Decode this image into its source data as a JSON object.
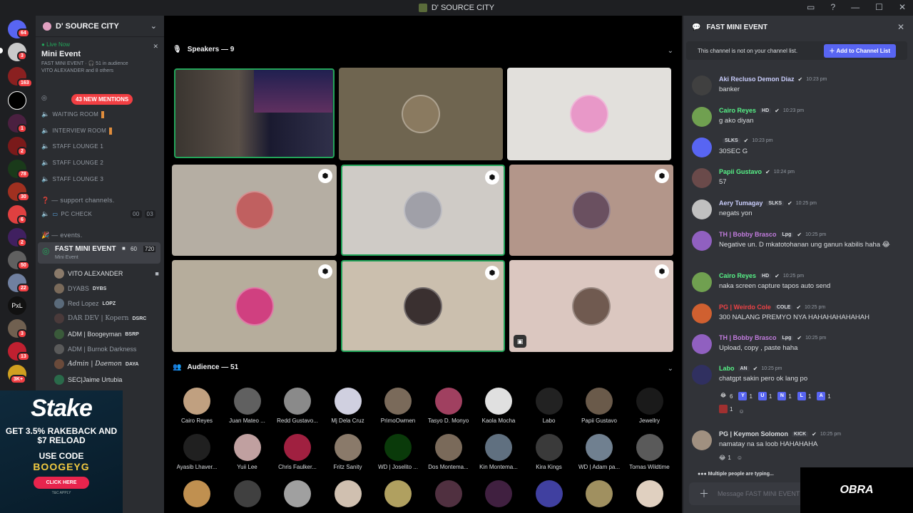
{
  "window": {
    "title": "D' SOURCE CITY"
  },
  "server_badges": [
    "64",
    "3",
    "163",
    "1",
    "2",
    "78",
    "30",
    "6",
    "2",
    "50",
    "22",
    "PxL",
    "3",
    "13",
    "3K+"
  ],
  "guild": {
    "name": "D' SOURCE CITY"
  },
  "live": {
    "status": "Live Now",
    "title": "Mini Event",
    "meta": "FAST MINI EVENT · 🎧 51 in audience",
    "sub": "VITO ALEXANDER and 8 others"
  },
  "mentions_pill": "43 NEW MENTIONS",
  "channels": [
    {
      "label": "WAITING ROOM"
    },
    {
      "label": "INTERVIEW ROOM"
    },
    {
      "label": "STAFF LOUNGE 1"
    },
    {
      "label": "STAFF LOUNGE 2"
    },
    {
      "label": "STAFF LOUNGE 3"
    }
  ],
  "support_cat": "❓ — support channels.",
  "pc_check": {
    "label": "PC CHECK",
    "c1": "00",
    "c2": "03"
  },
  "events_cat": "🎉 — events.",
  "active_channel": {
    "name": "FAST MINI EVENT",
    "sub": "Mini Event",
    "viewers": "60",
    "count": "720"
  },
  "members": [
    {
      "name": "VITO ALEXANDER",
      "tag": ""
    },
    {
      "name": "DYABS",
      "tag": "DYBS"
    },
    {
      "name": "Red Lopez",
      "tag": "LOPZ"
    },
    {
      "name": "DAR DEV | Kopern",
      "tag": "DSRC"
    },
    {
      "name": "ADM | Boogeyman",
      "tag": "BSRP"
    },
    {
      "name": "ADM | Burnok Darkness",
      "tag": ""
    },
    {
      "name": "Admin | Daemon",
      "tag": "DAYA"
    },
    {
      "name": "SEC|Jaime Urtubia",
      "tag": ""
    }
  ],
  "stake_ad": {
    "logo": "Stake",
    "line1": "GET 3.5% RAKEBACK AND $7 RELOAD",
    "line2": "USE CODE",
    "code": "BOOGEYG",
    "button": "CLICK HERE",
    "tc": "T&C APPLY"
  },
  "speakers": {
    "label": "Speakers — 9"
  },
  "audience": {
    "label": "Audience — 51",
    "names": [
      "Cairo Reyes",
      "Juan Mateo ...",
      "Redd Gustavo...",
      "Mj Dela Cruz",
      "PrimoOwmen",
      "Tasyo D. Monyo",
      "Kaola Mocha",
      "Labo",
      "Papii Gustavo",
      "Jewellry",
      "Ayasib Lhaver...",
      "Yuii Lee",
      "Chris Faulker...",
      "Fritz Sanity",
      "WD | Joselito ...",
      "Dos Montema...",
      "Kin Montema...",
      "Kira Kings",
      "WD | Adam pa...",
      "Tomas Wildtime"
    ]
  },
  "chat": {
    "title": "FAST MINI EVENT",
    "notice": "This channel is not on your channel list.",
    "add_button": "Add to Channel List",
    "messages": [
      {
        "name": "Aki Recluso Demon Diaz",
        "time": "10:23 pm",
        "text": "banker",
        "color": "#c9cdfb"
      },
      {
        "name": "Cairo Reyes",
        "tag": "HD",
        "time": "10:23 pm",
        "text": "g ako diyan",
        "color": "#57f287"
      },
      {
        "name": "",
        "tag": "SLKS",
        "time": "10:23 pm",
        "text": "30SEC G",
        "color": "#dbdee1"
      },
      {
        "name": "Papii Gustavo",
        "time": "10:24 pm",
        "text": "57",
        "color": "#57f287"
      },
      {
        "name": "Aery Tumagay",
        "tag": "SLKS",
        "time": "10:25 pm",
        "text": "negats yon",
        "color": "#c9cdfb"
      },
      {
        "name": "TH | Bobby Brasco",
        "tag": "Lpg",
        "time": "10:25 pm",
        "text": "Negative un. D mkatotohanan ung ganun kabilis haha 😂",
        "color": "#c27cde"
      },
      {
        "name": "Cairo Reyes",
        "tag": "HD",
        "time": "10:25 pm",
        "text": "naka screen capture tapos auto send",
        "color": "#57f287"
      },
      {
        "name": "PG | Weirdo Cole",
        "tag": "COLE",
        "time": "10:25 pm",
        "text": "300 NALANG PREMYO NYA HAHAHAHAHAHAH",
        "color": "#ed4245"
      },
      {
        "name": "TH | Bobby Brasco",
        "tag": "Lpg",
        "time": "10:25 pm",
        "text": "Upload, copy , paste haha",
        "color": "#c27cde"
      },
      {
        "name": "Labo",
        "tag": "AN",
        "time": "10:25 pm",
        "text": "chatgpt sakin pero ok lang po",
        "color": "#57f287"
      },
      {
        "name": "PG | Keymon Solomon",
        "tag": "KICK",
        "time": "10:25 pm",
        "text": "namatay na sa loob HAHAHAHA",
        "color": "#dbdee1"
      }
    ],
    "reactions": [
      {
        "e": "😂",
        "c": "6"
      },
      {
        "e": "Y",
        "c": "1"
      },
      {
        "e": "U",
        "c": "1"
      },
      {
        "e": "N",
        "c": "1"
      },
      {
        "e": "L",
        "c": "1"
      },
      {
        "e": "A",
        "c": "1"
      }
    ],
    "reaction_row2": "1",
    "keymon_reaction": "1",
    "typing": "Multiple people are typing...",
    "input_placeholder": "Message FAST MINI EVENT"
  },
  "overlay": {
    "brand": "OBRA"
  }
}
